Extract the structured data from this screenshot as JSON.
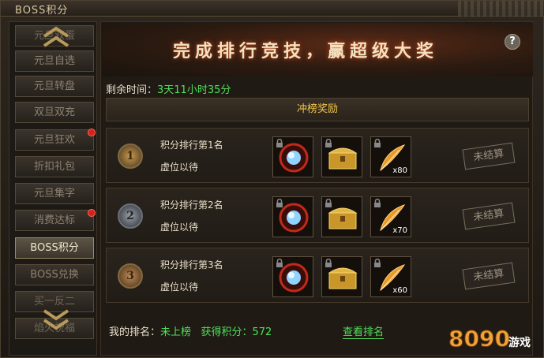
{
  "window": {
    "title": "BOSS积分"
  },
  "sidebar": {
    "items": [
      {
        "label": "元旦双蛋",
        "state": "dim"
      },
      {
        "label": "元旦自选",
        "state": "normal"
      },
      {
        "label": "元旦转盘",
        "state": "normal"
      },
      {
        "label": "双旦双充",
        "state": "normal"
      },
      {
        "label": "元旦狂欢",
        "state": "normal",
        "badge": true
      },
      {
        "label": "折扣礼包",
        "state": "normal"
      },
      {
        "label": "元旦集字",
        "state": "normal"
      },
      {
        "label": "消费达标",
        "state": "normal",
        "badge": true
      },
      {
        "label": "BOSS积分",
        "state": "active"
      },
      {
        "label": "BOSS兑换",
        "state": "normal"
      },
      {
        "label": "买一反二",
        "state": "dim"
      },
      {
        "label": "焰火祝福",
        "state": "dim"
      }
    ],
    "up_icon": "double-chevron-up-icon",
    "down_icon": "double-chevron-down-icon"
  },
  "banner": {
    "text": "完成排行竞技，赢超级大奖",
    "help": "?"
  },
  "timer": {
    "label": "剩余时间：",
    "value": "3天11小时35分"
  },
  "reward_header": "冲榜奖励",
  "ranks": [
    {
      "medal": "1",
      "title": "积分排行第1名",
      "holder": "虚位以待",
      "rewards": [
        {
          "icon": "blue-gem-orb-icon",
          "qty": ""
        },
        {
          "icon": "golden-chest-icon",
          "qty": ""
        },
        {
          "icon": "golden-feather-icon",
          "qty": "x80"
        }
      ],
      "status": "未结算"
    },
    {
      "medal": "2",
      "title": "积分排行第2名",
      "holder": "虚位以待",
      "rewards": [
        {
          "icon": "blue-gem-orb-icon",
          "qty": ""
        },
        {
          "icon": "golden-chest-icon",
          "qty": ""
        },
        {
          "icon": "golden-feather-icon",
          "qty": "x70"
        }
      ],
      "status": "未结算"
    },
    {
      "medal": "3",
      "title": "积分排行第3名",
      "holder": "虚位以待",
      "rewards": [
        {
          "icon": "blue-gem-orb-icon",
          "qty": ""
        },
        {
          "icon": "golden-chest-icon",
          "qty": ""
        },
        {
          "icon": "golden-feather-icon",
          "qty": "x60"
        }
      ],
      "status": "未结算"
    }
  ],
  "footer": {
    "my_rank_label": "我的排名：",
    "my_rank_value": "未上榜",
    "points_label": "获得积分：",
    "points_value": "572",
    "view_link": "查看排名"
  },
  "watermark": {
    "text": "8090游戏"
  },
  "colors": {
    "accent_green": "#4fe05a",
    "gold": "#f4c64a",
    "badge_red": "#d5211b"
  }
}
